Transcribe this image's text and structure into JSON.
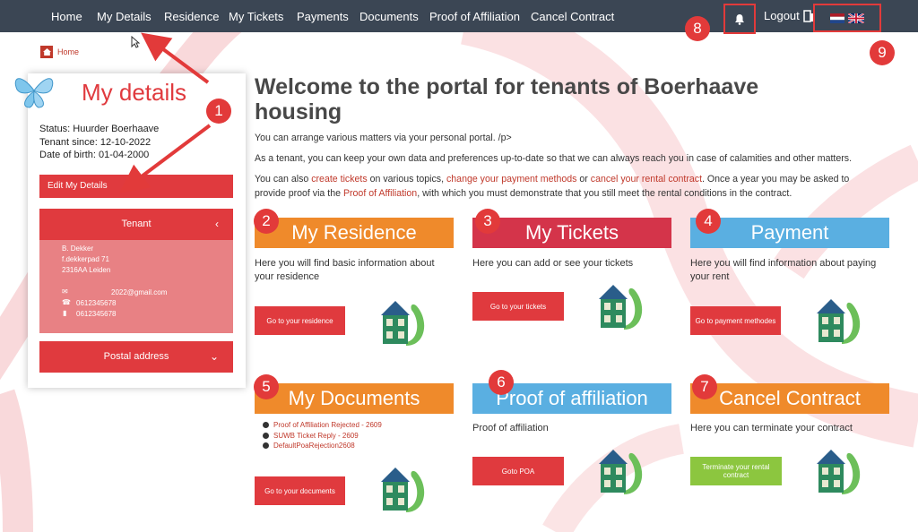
{
  "nav": {
    "items": [
      "Home",
      "My Details",
      "Residence",
      "My Tickets",
      "Payments",
      "Documents",
      "Proof of Affiliation",
      "Cancel Contract"
    ],
    "logout": "Logout",
    "bell_icon": "bell-icon",
    "language_flags": [
      "flag-nl-icon",
      "flag-uk-icon"
    ]
  },
  "callouts": [
    "1",
    "2",
    "3",
    "4",
    "5",
    "6",
    "7",
    "8",
    "9"
  ],
  "breadcrumb": {
    "home": "Home"
  },
  "sidebar": {
    "title": "My details",
    "status": "Status: Huurder Boerhaave",
    "tenant_since": "Tenant since: 12-10-2022",
    "dob": "Date of birth: 01-04-2000",
    "edit_label": "Edit My Details",
    "tenant_label": "Tenant",
    "tenant": {
      "name": "B. Dekker",
      "street": "f.dekkerpad 71",
      "city": "2316AA Leiden",
      "email": "2022@gmail.com",
      "phone": "0612345678",
      "mobile": "0612345678"
    },
    "postal_label": "Postal address"
  },
  "main": {
    "title": "Welcome to the portal for tenants of Boerhaave housing",
    "p1": "You can arrange various matters via your personal portal. /p>",
    "p2": "As a tenant, you can keep your own data and preferences up-to-date so that we can always reach you in case of calamities and other matters.",
    "p3": {
      "a": "You can also ",
      "link1": "create tickets",
      "b": " on various topics, ",
      "link2": "change your payment methods",
      "c": " or ",
      "link3": "cancel your rental contract",
      "d": ". Once a year you may be asked to",
      "e": "provide proof via the ",
      "link4": "Proof of Affiliation",
      "f": ", with which you must demonstrate that you still meet the rental conditions in the contract."
    }
  },
  "tiles": [
    {
      "title": "My Residence",
      "text": "Here you will find basic information about your residence",
      "button": "Go to your residence"
    },
    {
      "title": "My Tickets",
      "text": "Here you can add or see your tickets",
      "button": "Go to your tickets"
    },
    {
      "title": "Payment",
      "text": "Here you will find information about paying your rent",
      "button": "Go to payment methodes"
    },
    {
      "title": "My Documents",
      "docs": [
        "Proof of Affiliation Rejected - 2609",
        "SUWB Ticket Reply - 2609",
        "DefaultPoaRejection2608"
      ],
      "button": "Go to your documents"
    },
    {
      "title": "Proof of affiliation",
      "text": "Proof of affiliation",
      "button": "Goto POA"
    },
    {
      "title": "Cancel Contract",
      "text": "Here  you can terminate your contract",
      "button": "Terminate your rental contract"
    }
  ],
  "colors": {
    "accent": "#e03a3e",
    "nav": "#3b4654",
    "orange": "#ef8a2b",
    "crimson": "#d4344a",
    "blue": "#5aafe1",
    "green": "#8cc63f"
  }
}
